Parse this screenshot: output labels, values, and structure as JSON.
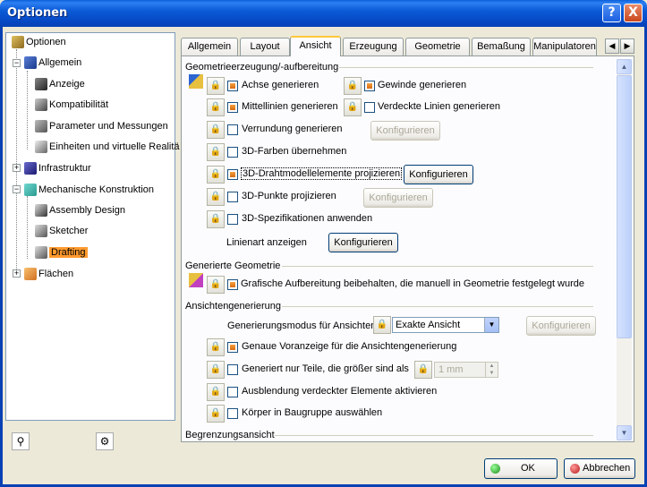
{
  "window": {
    "title": "Optionen",
    "help_icon": "?",
    "close_icon": "X"
  },
  "tree": {
    "items": [
      {
        "label": "Optionen",
        "icon": "options-icon"
      },
      {
        "label": "Allgemein",
        "icon": "general-icon"
      },
      {
        "label": "Anzeige",
        "icon": "display-icon"
      },
      {
        "label": "Kompatibilität",
        "icon": "compatibility-icon"
      },
      {
        "label": "Parameter und Messungen",
        "icon": "parameters-icon"
      },
      {
        "label": "Einheiten und virtuelle Realitä",
        "icon": "units-icon"
      },
      {
        "label": "Infrastruktur",
        "icon": "infrastructure-icon"
      },
      {
        "label": "Mechanische Konstruktion",
        "icon": "mechanical-design-icon"
      },
      {
        "label": "Assembly Design",
        "icon": "assembly-icon"
      },
      {
        "label": "Sketcher",
        "icon": "sketcher-icon"
      },
      {
        "label": "Drafting",
        "icon": "drafting-icon"
      },
      {
        "label": "Flächen",
        "icon": "surfaces-icon"
      }
    ]
  },
  "tabs": [
    "Allgemein",
    "Layout",
    "Ansicht",
    "Erzeugung",
    "Geometrie",
    "Bemaßung",
    "Manipulatoren"
  ],
  "active_tab": "Ansicht",
  "sections": {
    "geo": {
      "title": "Geometrieerzeugung/-aufbereitung",
      "achse": "Achse generieren",
      "gewinde": "Gewinde generieren",
      "mittellinien": "Mittellinien generieren",
      "verdeckte": "Verdeckte Linien generieren",
      "verrundung": "Verrundung generieren",
      "farben": "3D-Farben übernehmen",
      "draht": "3D-Drahtmodellelemente projizieren",
      "punkte": "3D-Punkte projizieren",
      "spez": "3D-Spezifikationen anwenden",
      "linienart": "Linienart anzeigen"
    },
    "gen_geo": {
      "title": "Generierte Geometrie",
      "grafische": "Grafische Aufbereitung beibehalten, die manuell in Geometrie festgelegt wurde"
    },
    "ansicht": {
      "title": "Ansichtengenerierung",
      "modus": "Generierungsmodus für Ansichten",
      "modus_value": "Exakte Ansicht",
      "genaue": "Genaue Voranzeige für die Ansichtengenerierung",
      "nur_teile": "Generiert nur Teile, die größer sind als",
      "groesse": "1 mm",
      "ausblendung": "Ausblendung verdeckter Elemente aktivieren",
      "koerper": "Körper in Baugruppe auswählen"
    },
    "begrenzung": {
      "title": "Begrenzungsansicht"
    }
  },
  "buttons": {
    "configure": "Konfigurieren",
    "ok": "OK",
    "cancel": "Abbrechen"
  },
  "colors": {
    "title_bar": "#0b5ad6",
    "selection": "#ff9a2e",
    "check_fill": "#e8871e",
    "ok_icon": "#2ea52e",
    "cancel_icon": "#d83a2a"
  }
}
